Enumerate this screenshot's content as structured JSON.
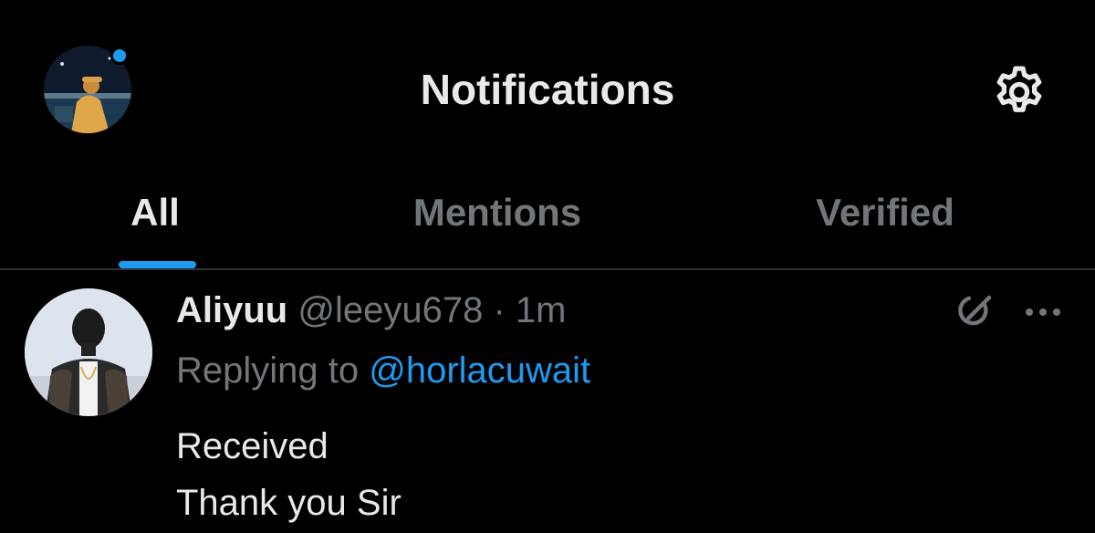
{
  "header": {
    "title": "Notifications",
    "has_unread_dot": true,
    "profile_avatar_icon": "profile-photo",
    "settings_icon": "gear-icon"
  },
  "tabs": [
    {
      "label": "All",
      "active": true
    },
    {
      "label": "Mentions",
      "active": false
    },
    {
      "label": "Verified",
      "active": false
    }
  ],
  "notification": {
    "author_name": "Aliyuu",
    "author_handle": "@leeyu678",
    "separator": "·",
    "time": "1m",
    "replying_prefix": "Replying to",
    "replying_to": "@horlacuwait",
    "body_lines": [
      "Received",
      "Thank you Sir"
    ],
    "icons": [
      "grok-icon",
      "more-options-icon"
    ]
  },
  "colors": {
    "background": "#000000",
    "primary_text": "#e7e9ea",
    "secondary_text": "#71767b",
    "accent": "#1d9bf0",
    "divider": "#2f3336"
  }
}
